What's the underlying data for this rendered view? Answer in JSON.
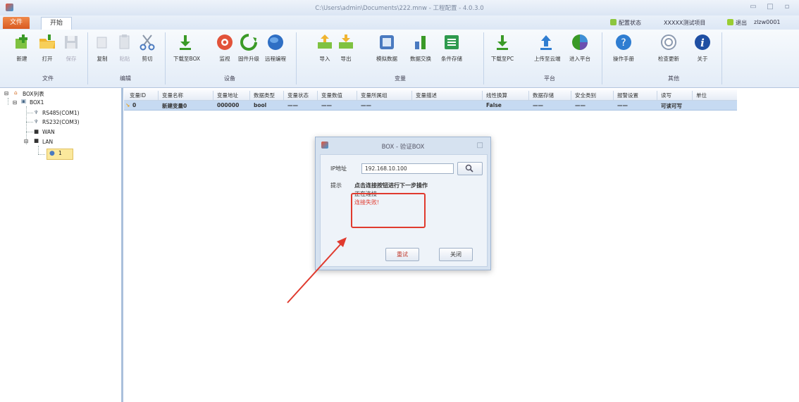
{
  "window": {
    "title": "C:\\Users\\admin\\Documents\\222.mnw - 工程配置 - 4.0.3.0",
    "min": "▭",
    "max": "□",
    "close": "▫"
  },
  "ribbon_tabs": {
    "file": "文件",
    "start": "开始",
    "login_status": "配置状态",
    "project": "XXXXX测试项目",
    "logout": "退出",
    "user": "zlzw0001"
  },
  "ribbon": {
    "buttons": [
      {
        "label": "新建",
        "icon": "new-icon"
      },
      {
        "label": "打开",
        "icon": "open-folder-icon"
      },
      {
        "label": "保存",
        "icon": "save-icon"
      },
      {
        "label": "复制",
        "icon": "copy-icon"
      },
      {
        "label": "粘贴",
        "icon": "paste-icon"
      },
      {
        "label": "剪切",
        "icon": "cut-icon"
      },
      {
        "label": "下载至BOX",
        "icon": "download-icon"
      },
      {
        "label": "监视",
        "icon": "monitor-icon"
      },
      {
        "label": "固件升级",
        "icon": "firmware-upgrade-icon"
      },
      {
        "label": "远程编程",
        "icon": "remote-program-icon"
      },
      {
        "label": "导入",
        "icon": "import-icon"
      },
      {
        "label": "导出",
        "icon": "export-icon"
      },
      {
        "label": "模拟数据",
        "icon": "simulate-data-icon"
      },
      {
        "label": "数据交换",
        "icon": "data-exchange-icon"
      },
      {
        "label": "条件存储",
        "icon": "condition-store-icon"
      },
      {
        "label": "下载至PC",
        "icon": "download-pc-icon"
      },
      {
        "label": "上传至云端",
        "icon": "upload-cloud-icon"
      },
      {
        "label": "进入平台",
        "icon": "platform-icon"
      },
      {
        "label": "操作手册",
        "icon": "help-icon"
      },
      {
        "label": "检查更新",
        "icon": "update-icon"
      },
      {
        "label": "关于",
        "icon": "info-icon"
      }
    ],
    "groups": [
      "文件",
      "编辑",
      "设备",
      "变量",
      "平台",
      "其他"
    ]
  },
  "tree": {
    "root": "BOX列表",
    "box": "BOX1",
    "rs485": "RS485(COM1)",
    "rs232": "RS232(COM3)",
    "wan": "WAN",
    "lan": "LAN",
    "node": "1"
  },
  "grid": {
    "columns": [
      "变量ID",
      "变量名称",
      "变量地址",
      "数据类型",
      "变量状态",
      "变量数值",
      "变量所属组",
      "变量描述",
      "线性换算",
      "数据存储",
      "安全类别",
      "报警设置",
      "读写",
      "单位"
    ],
    "row": {
      "id": "0",
      "name": "新建变量0",
      "address": "000000",
      "type": "bool",
      "state": "——",
      "value": "——",
      "group": "——",
      "linear": "False",
      "storage": "——",
      "safety": "——",
      "alarm": "——",
      "rw": "可读可写"
    }
  },
  "dialog": {
    "title": "BOX - 验证BOX",
    "ip_label": "IP地址",
    "ip_value": "192.168.10.100",
    "hint_label": "提示",
    "hint_text": "点击连接按钮进行下一步操作",
    "connecting": "正在连接",
    "failed": "连接失败!",
    "retry": "重试",
    "close": "关闭"
  },
  "colors": {
    "accent_orange": "#e5692b",
    "selection_blue": "#c6daf2",
    "error_red": "#e03a2e",
    "arrow_red": "#e03a2e"
  }
}
